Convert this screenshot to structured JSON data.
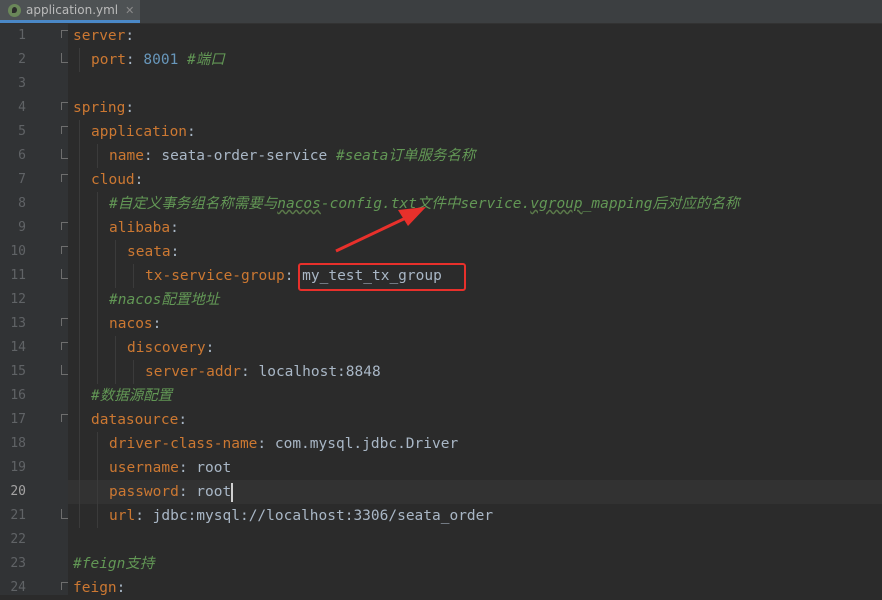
{
  "tab": {
    "filename": "application.yml",
    "close": "✕"
  },
  "current_line": 20,
  "lines": [
    {
      "n": "1",
      "indent": 0,
      "fold": "open",
      "tokens": [
        {
          "cls": "k",
          "text": "server"
        },
        {
          "cls": "t",
          "text": ":"
        }
      ]
    },
    {
      "n": "2",
      "indent": 1,
      "fold": "close",
      "tokens": [
        {
          "cls": "k",
          "text": "port"
        },
        {
          "cls": "t",
          "text": ": "
        },
        {
          "cls": "n",
          "text": "8001"
        },
        {
          "cls": "t",
          "text": " "
        },
        {
          "cls": "c",
          "text": "#端口"
        }
      ]
    },
    {
      "n": "3",
      "indent": 0,
      "fold": "",
      "tokens": []
    },
    {
      "n": "4",
      "indent": 0,
      "fold": "open",
      "tokens": [
        {
          "cls": "k",
          "text": "spring"
        },
        {
          "cls": "t",
          "text": ":"
        }
      ]
    },
    {
      "n": "5",
      "indent": 1,
      "fold": "open",
      "tokens": [
        {
          "cls": "k",
          "text": "application"
        },
        {
          "cls": "t",
          "text": ":"
        }
      ]
    },
    {
      "n": "6",
      "indent": 2,
      "fold": "close",
      "tokens": [
        {
          "cls": "k",
          "text": "name"
        },
        {
          "cls": "t",
          "text": ": seata-order-service "
        },
        {
          "cls": "c",
          "text": "#seata订单服务名称"
        }
      ]
    },
    {
      "n": "7",
      "indent": 1,
      "fold": "open",
      "tokens": [
        {
          "cls": "k",
          "text": "cloud"
        },
        {
          "cls": "t",
          "text": ":"
        }
      ]
    },
    {
      "n": "8",
      "indent": 2,
      "fold": "",
      "tokens": [
        {
          "cls": "c",
          "text": "#自定义事务组名称需要与"
        },
        {
          "cls": "c tu",
          "text": "nacos"
        },
        {
          "cls": "c",
          "text": "-config.txt文件中service."
        },
        {
          "cls": "c tu",
          "text": "vgroup"
        },
        {
          "cls": "c",
          "text": "_mapping后对应的名称"
        }
      ]
    },
    {
      "n": "9",
      "indent": 2,
      "fold": "open",
      "tokens": [
        {
          "cls": "k",
          "text": "alibaba"
        },
        {
          "cls": "t",
          "text": ":"
        }
      ]
    },
    {
      "n": "10",
      "indent": 3,
      "fold": "open",
      "tokens": [
        {
          "cls": "k",
          "text": "seata"
        },
        {
          "cls": "t",
          "text": ":"
        }
      ]
    },
    {
      "n": "11",
      "indent": 4,
      "fold": "close",
      "tokens": [
        {
          "cls": "k",
          "text": "tx-service-group"
        },
        {
          "cls": "t",
          "text": ": my_test_tx_group"
        }
      ]
    },
    {
      "n": "12",
      "indent": 2,
      "fold": "",
      "tokens": [
        {
          "cls": "c",
          "text": "#nacos配置地址"
        }
      ]
    },
    {
      "n": "13",
      "indent": 2,
      "fold": "open",
      "tokens": [
        {
          "cls": "k",
          "text": "nacos"
        },
        {
          "cls": "t",
          "text": ":"
        }
      ]
    },
    {
      "n": "14",
      "indent": 3,
      "fold": "open",
      "tokens": [
        {
          "cls": "k",
          "text": "discovery"
        },
        {
          "cls": "t",
          "text": ":"
        }
      ]
    },
    {
      "n": "15",
      "indent": 4,
      "fold": "close",
      "tokens": [
        {
          "cls": "k",
          "text": "server-addr"
        },
        {
          "cls": "t",
          "text": ": localhost:8848"
        }
      ]
    },
    {
      "n": "16",
      "indent": 1,
      "fold": "",
      "tokens": [
        {
          "cls": "c",
          "text": "#数据源配置"
        }
      ]
    },
    {
      "n": "17",
      "indent": 1,
      "fold": "open",
      "tokens": [
        {
          "cls": "k",
          "text": "datasource"
        },
        {
          "cls": "t",
          "text": ":"
        }
      ]
    },
    {
      "n": "18",
      "indent": 2,
      "fold": "",
      "tokens": [
        {
          "cls": "k",
          "text": "driver-class-name"
        },
        {
          "cls": "t",
          "text": ": com.mysql.jdbc.Driver"
        }
      ]
    },
    {
      "n": "19",
      "indent": 2,
      "fold": "",
      "tokens": [
        {
          "cls": "k",
          "text": "username"
        },
        {
          "cls": "t",
          "text": ": root"
        }
      ]
    },
    {
      "n": "20",
      "indent": 2,
      "fold": "",
      "tokens": [
        {
          "cls": "k",
          "text": "password"
        },
        {
          "cls": "t",
          "text": ": root"
        }
      ]
    },
    {
      "n": "21",
      "indent": 2,
      "fold": "close",
      "tokens": [
        {
          "cls": "k",
          "text": "url"
        },
        {
          "cls": "t",
          "text": ": jdbc:mysql://localhost:3306/seata_order"
        }
      ]
    },
    {
      "n": "22",
      "indent": 0,
      "fold": "",
      "tokens": []
    },
    {
      "n": "23",
      "indent": 0,
      "fold": "",
      "tokens": [
        {
          "cls": "c",
          "text": "#feign支持"
        }
      ]
    },
    {
      "n": "24",
      "indent": 0,
      "fold": "open",
      "tokens": [
        {
          "cls": "k",
          "text": "feign"
        },
        {
          "cls": "t",
          "text": ":"
        }
      ]
    }
  ],
  "annotation": {
    "color": "#e8302b"
  }
}
